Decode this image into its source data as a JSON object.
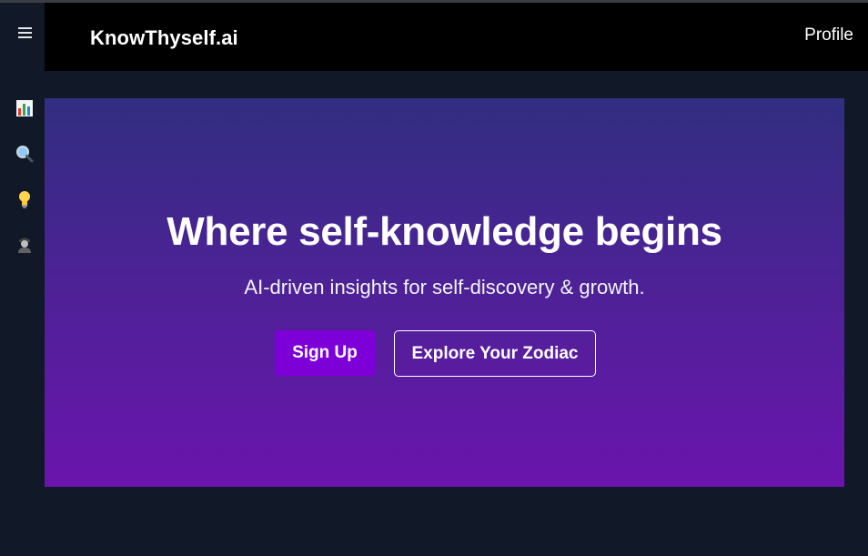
{
  "header": {
    "brand": "KnowThyself.ai",
    "profile_label": "Profile"
  },
  "sidebar": {
    "menu_icon": "hamburger-menu-icon",
    "items": [
      {
        "icon": "bar-chart-icon"
      },
      {
        "icon": "magnifier-icon"
      },
      {
        "icon": "lightbulb-icon"
      },
      {
        "icon": "person-icon"
      }
    ]
  },
  "hero": {
    "title": "Where self-knowledge begins",
    "subtitle": "AI-driven insights for self-discovery & growth.",
    "signup_label": "Sign Up",
    "zodiac_label": "Explore Your Zodiac"
  },
  "colors": {
    "page_background": "#111827",
    "header_background": "#000000",
    "hero_gradient_top": "#312e81",
    "hero_gradient_bottom": "#6b14ad",
    "signup_button": "#7e00d8"
  }
}
